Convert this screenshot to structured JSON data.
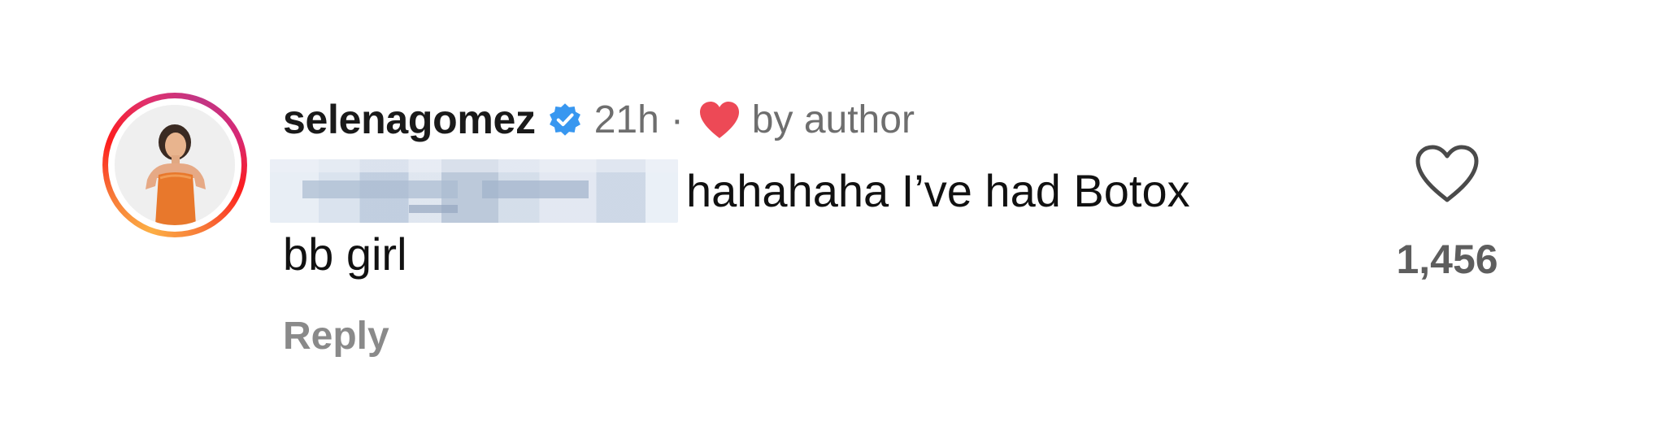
{
  "comment": {
    "username": "selenagomez",
    "verified": true,
    "timestamp": "21h",
    "separator": "·",
    "liked_by_author_label": "by author",
    "text_line1": "hahahaha I’ve had Botox",
    "text_line2": "bb girl",
    "reply_label": "Reply",
    "like_count": "1,456"
  },
  "icons": {
    "verified": "verified-badge-icon",
    "author_heart": "heart-filled-icon",
    "like": "heart-outline-icon"
  },
  "colors": {
    "verified_blue": "#3897f0",
    "heart_red": "#ed4956",
    "secondary_text": "#6e6e6e"
  }
}
